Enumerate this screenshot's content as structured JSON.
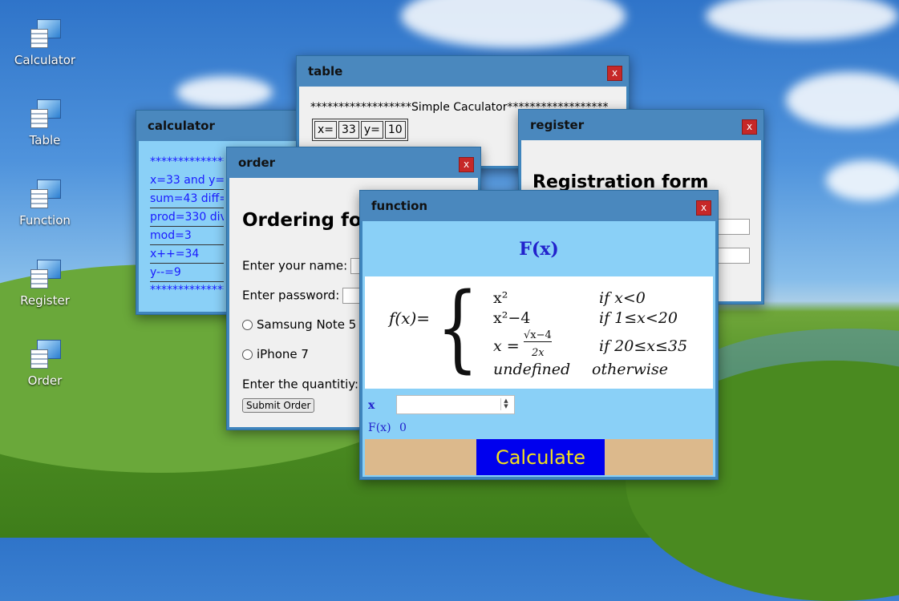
{
  "desktop": {
    "icons": [
      {
        "label": "Calculator",
        "icon": "computer-icon"
      },
      {
        "label": "Table",
        "icon": "computer-icon"
      },
      {
        "label": "Function",
        "icon": "computer-icon"
      },
      {
        "label": "Register",
        "icon": "computer-icon"
      },
      {
        "label": "Order",
        "icon": "computer-icon"
      }
    ]
  },
  "close_label": "x",
  "calculator": {
    "title": "calculator",
    "lines": [
      "*****************",
      "x=33 and y=10",
      "sum=43 diff=23",
      "prod=330 div=3",
      "mod=3",
      "x++=34",
      "y--=9",
      "*****************"
    ]
  },
  "table": {
    "title": "table",
    "header": "******************Simple Caculator******************",
    "cells": [
      "x=",
      "33",
      "y=",
      "10"
    ]
  },
  "register": {
    "title": "register",
    "heading": "Registration form"
  },
  "order": {
    "title": "order",
    "heading": "Ordering form",
    "name_label": "Enter your name:",
    "password_label": "Enter password:",
    "option1": "Samsung Note 5",
    "option2": "iPhone 7",
    "quantity_label": "Enter the quantitiy:",
    "submit_label": "Submit Order"
  },
  "function": {
    "title": "function",
    "heading": "F(x)",
    "formula": {
      "lhs": "f(x)=",
      "cases": [
        {
          "expr": "x²",
          "cond": "if x<0"
        },
        {
          "expr": "x²−4",
          "cond": "if 1≤x<20"
        },
        {
          "expr": "x = √(x−4) / 2x",
          "cond": "if 20≤x≤35"
        },
        {
          "expr": "undefined",
          "cond": "otherwise"
        }
      ],
      "sqrt_num": "√x−4",
      "sqrt_den": "2x",
      "x_eq": "x ="
    },
    "x_label": "x",
    "x_value": "",
    "fx_label": "F(x)",
    "fx_value": "0",
    "calculate_label": "Calculate"
  }
}
